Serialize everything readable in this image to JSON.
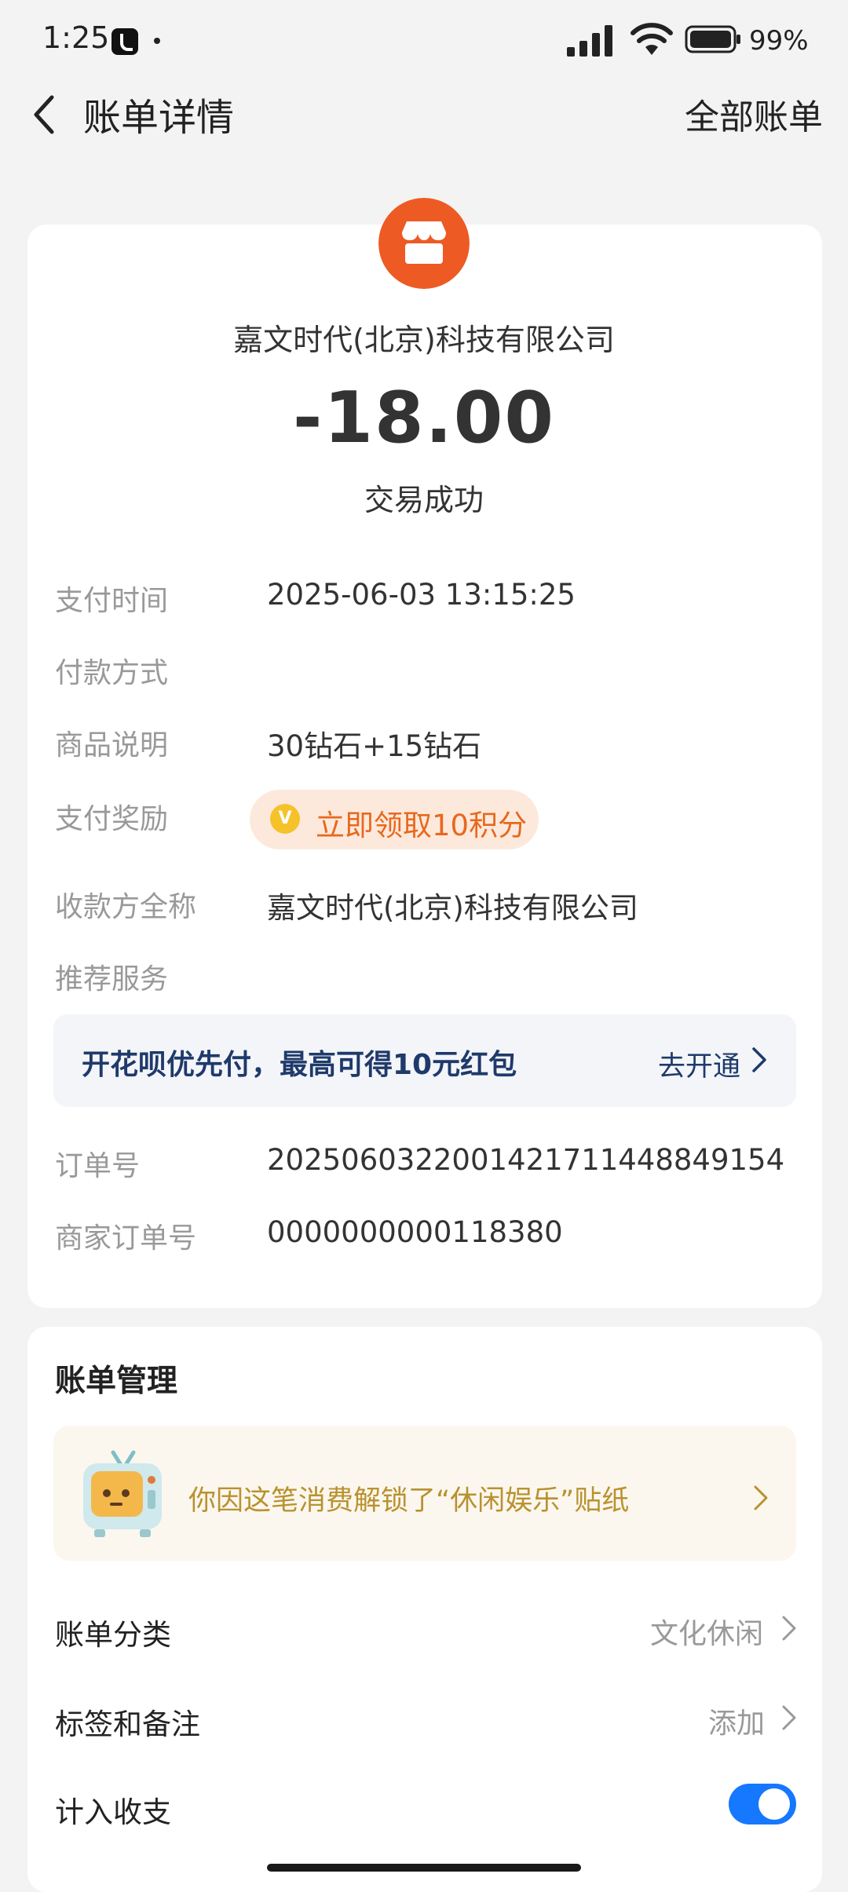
{
  "status_bar": {
    "time": "1:25",
    "battery": "99%",
    "icons": [
      "tiktok-icon",
      "signal-icon",
      "wifi-icon",
      "battery-icon"
    ]
  },
  "nav": {
    "title": "账单详情",
    "right_link": "全部账单",
    "back_icon": "chevron-left-icon"
  },
  "transaction": {
    "merchant_icon": "shop-icon",
    "merchant_color": "#ee5a24",
    "merchant_name": "嘉文时代(北京)科技有限公司",
    "amount": "-18.00",
    "status": "交易成功"
  },
  "details": {
    "pay_time_label": "支付时间",
    "pay_time": "2025-06-03 13:15:25",
    "pay_method_label": "付款方式",
    "product_label": "商品说明",
    "product": "30钻石+15钻石",
    "reward_label": "支付奖励",
    "reward_button": "立即领取10积分",
    "reward_icon": "coin-icon",
    "payee_label": "收款方全称",
    "payee": "嘉文时代(北京)科技有限公司",
    "recommend_label": "推荐服务",
    "order_no_label": "订单号",
    "order_no": "2025060322001421711448849154",
    "merchant_order_label": "商家订单号",
    "merchant_order_no": "0000000000118380"
  },
  "huabei_banner": {
    "text": "开花呗优先付，最高可得10元红包",
    "link": "去开通"
  },
  "management": {
    "title": "账单管理",
    "sticker_text": "你因这笔消费解锁了“休闲娱乐”贴纸",
    "category_label": "账单分类",
    "category_value": "文化休闲",
    "tags_label": "标签和备注",
    "tags_value": "添加",
    "count_label": "计入收支",
    "count_enabled": true
  },
  "colors": {
    "accent_blue": "#1677ff",
    "reward_orange": "#e8681e",
    "banner_navy": "#1f3a6a"
  }
}
